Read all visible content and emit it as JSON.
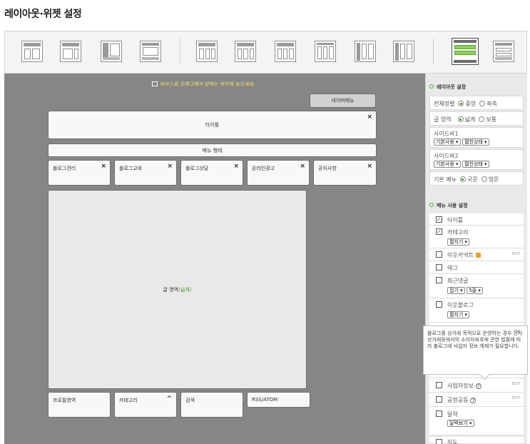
{
  "page_title": "레이아웃·위젯 설정",
  "canvas": {
    "hint": "마우스로 드래그해서 원하는 위치에 놓으세요.",
    "nav_label": "네이버메뉴",
    "title_widget": "타이틀",
    "menu_bar": "메뉴 형태",
    "tabs": [
      "블로그관리",
      "블로그교육",
      "블로그상담",
      "온라인광고",
      "공지사항"
    ],
    "content_prefix": "글 영역",
    "content_suffix": "(넓게)",
    "bottom": [
      "프로필영역",
      "카테고리",
      "검색",
      "RSS/ATOM"
    ]
  },
  "panel": {
    "layout_section": "레이아웃 설정",
    "align_label": "전체정렬",
    "align_opt1": "중앙",
    "align_opt2": "좌측",
    "area_label": "글 영역",
    "area_opt1": "넓게",
    "area_opt2": "보통",
    "sidebar1_label": "사이드바1",
    "sidebar2_label": "사이드바2",
    "sidebar_use": "기본사용",
    "sidebar_state": "펼친상태",
    "menu_label": "기본 메뉴",
    "menu_opt1": "국문",
    "menu_opt2": "영문",
    "menu_section": "메뉴 사용 설정",
    "items": {
      "title": "타이틀",
      "category": "카테고리",
      "category_sel": "펼치기",
      "neighbor_comment": "이웃커넥트",
      "tag": "태그",
      "recent_comment": "최근댓글",
      "recent_sel1": "접기",
      "recent_sel2": "5줄",
      "neighbor_blog": "이웃블로그",
      "neighbor_sel": "펼치기",
      "biz_info": "사업자정보",
      "biz_joint": "공정공동",
      "calendar": "달력",
      "calendar_sel": "달력보기",
      "map": "지도"
    },
    "edit": "EDIT"
  },
  "tooltip": {
    "text": "블로그를 상거래 목적으로 운영하는 경우 전자상거래등에서의 소비자보호에 관한 법률에 따라 블로그에 사업자 정보 게재가 필요합니다.",
    "close": "✕"
  },
  "colors": {
    "canvas_bg": "#848688",
    "accent_green": "#54a83a",
    "hint": "#ffe55a"
  }
}
